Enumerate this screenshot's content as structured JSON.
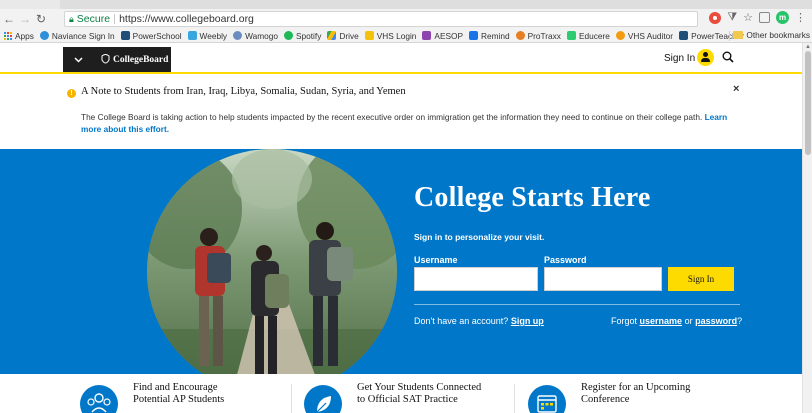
{
  "browser": {
    "nav": {
      "back_icon": "arrow-left-icon",
      "forward_icon": "arrow-right-icon",
      "reload_icon": "reload-icon"
    },
    "omnibox": {
      "secure_label": "Secure",
      "url": "https://www.collegeboard.org"
    },
    "toolbar_icons": [
      "extension-red-icon",
      "filter-icon",
      "star-icon",
      "extension-box-icon",
      "extension-green-icon",
      "kebab-menu-icon"
    ],
    "bookmarks": [
      {
        "label": "Apps",
        "color": "#4285f4"
      },
      {
        "label": "Naviance Sign In",
        "color": "#2f8fd8"
      },
      {
        "label": "PowerSchool",
        "color": "#1f4e79"
      },
      {
        "label": "Weebly",
        "color": "#3aa6e0"
      },
      {
        "label": "Wamogo",
        "color": "#6c8ebf"
      },
      {
        "label": "Spotify",
        "color": "#1db954"
      },
      {
        "label": "Drive",
        "color": "#34a853"
      },
      {
        "label": "VHS Login",
        "color": "#f4c20d"
      },
      {
        "label": "AESOP",
        "color": "#8e44ad"
      },
      {
        "label": "Remind",
        "color": "#1a73e8"
      },
      {
        "label": "ProTraxx",
        "color": "#e67e22"
      },
      {
        "label": "Educere",
        "color": "#2ecc71"
      },
      {
        "label": "VHS Auditor",
        "color": "#f39c12"
      },
      {
        "label": "PowerTeacher",
        "color": "#1f4e79"
      }
    ],
    "other_bookmarks": "Other bookmarks"
  },
  "header": {
    "menu_icon": "chevron-down-icon",
    "logo_text": "CollegeBoard",
    "signin_label": "Sign In",
    "brand_yellow": "#fedb00",
    "brand_blue": "#0077c8"
  },
  "alert": {
    "title": "A Note to Students from Iran, Iraq, Libya, Somalia, Sudan, Syria, and Yemen",
    "body": "The College Board is taking action to help students impacted by the recent executive order on immigration get the information they need to continue on their college path.",
    "link": "Learn more about this effort.",
    "close_glyph": "×"
  },
  "hero": {
    "title": "College Starts Here",
    "subtitle": "Sign in to personalize your visit.",
    "username_label": "Username",
    "password_label": "Password",
    "signin_button": "Sign In",
    "no_account_text": "Don't have an account?",
    "signup_link": "Sign up",
    "forgot_text": "Forgot",
    "username_link": "username",
    "or_text": "or",
    "password_link": "password",
    "question": "?"
  },
  "promos": [
    {
      "line1": "Find and Encourage",
      "line2": "Potential AP Students",
      "icon": "people-group-icon"
    },
    {
      "line1": "Get Your Students Connected",
      "line2": "to Official SAT Practice",
      "icon": "leaf-icon"
    },
    {
      "line1": "Register for an Upcoming",
      "line2": "Conference",
      "icon": "calendar-icon"
    }
  ]
}
